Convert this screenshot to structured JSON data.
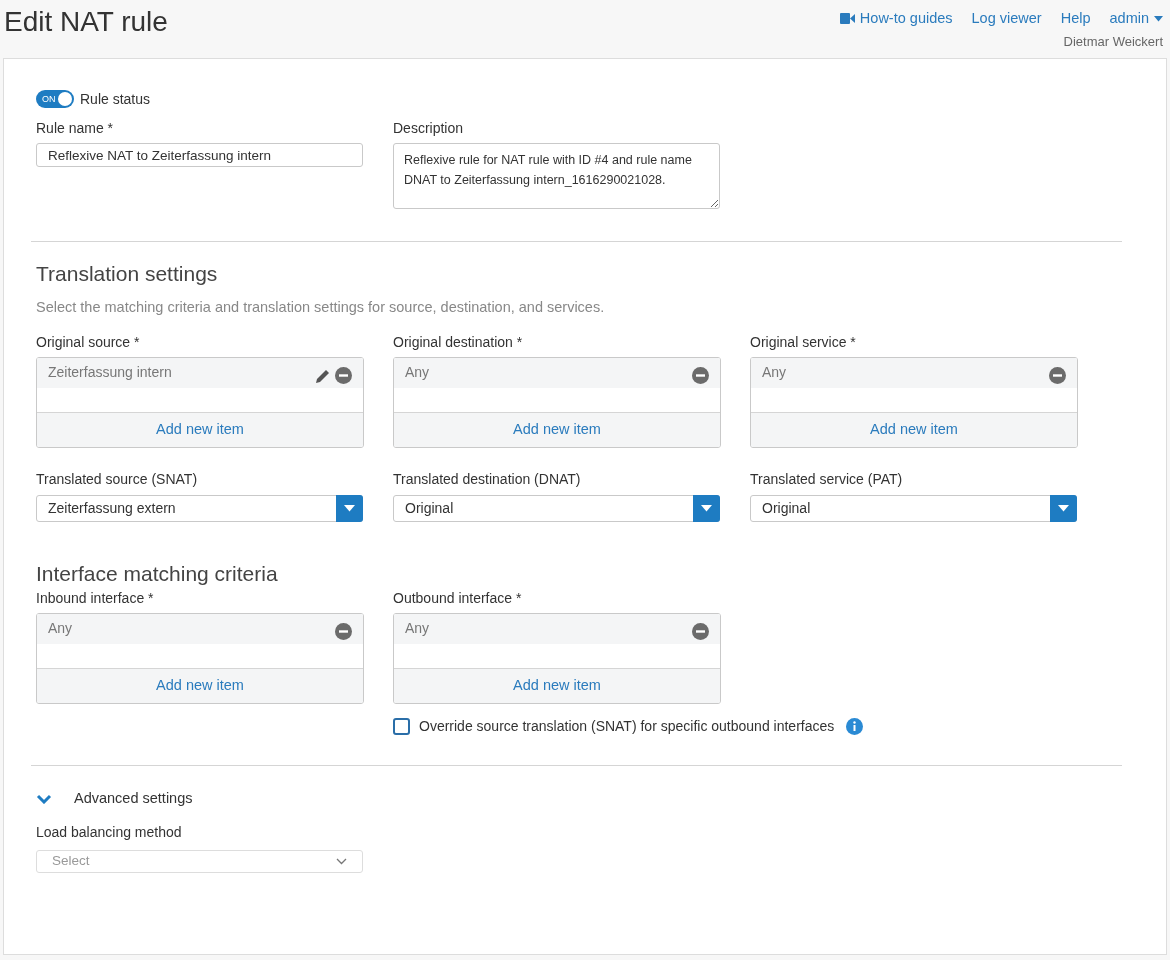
{
  "header": {
    "title": "Edit NAT rule",
    "links": [
      {
        "label": "How-to guides",
        "kind": "video"
      },
      {
        "label": "Log viewer",
        "kind": "plain"
      },
      {
        "label": "Help",
        "kind": "plain"
      },
      {
        "label": "admin",
        "kind": "menu"
      }
    ],
    "user": "Dietmar Weickert"
  },
  "rule_status": {
    "on": true,
    "toggle_text": "ON",
    "label": "Rule status"
  },
  "rule_name": {
    "label": "Rule name *",
    "value": "Reflexive NAT to Zeiterfassung intern"
  },
  "description": {
    "label": "Description",
    "value": "Reflexive rule for NAT rule with ID #4 and rule name DNAT to Zeiterfassung intern_1616290021028."
  },
  "translation": {
    "title": "Translation settings",
    "subtitle": "Select the matching criteria and translation settings for source, destination, and services.",
    "pickers": [
      {
        "label": "Original source *",
        "item": "Zeiterfassung intern",
        "editable": true,
        "add_label": "Add new item"
      },
      {
        "label": "Original destination *",
        "item": "Any",
        "editable": false,
        "add_label": "Add new item"
      },
      {
        "label": "Original service *",
        "item": "Any",
        "editable": false,
        "add_label": "Add new item"
      }
    ],
    "selects": [
      {
        "label": "Translated source (SNAT)",
        "value": "Zeiterfassung extern"
      },
      {
        "label": "Translated destination (DNAT)",
        "value": "Original"
      },
      {
        "label": "Translated service (PAT)",
        "value": "Original"
      }
    ]
  },
  "interface": {
    "title": "Interface matching criteria",
    "pickers": [
      {
        "label": "Inbound interface *",
        "item": "Any",
        "editable": false,
        "add_label": "Add new item"
      },
      {
        "label": "Outbound interface *",
        "item": "Any",
        "editable": false,
        "add_label": "Add new item"
      }
    ],
    "override": {
      "checked": false,
      "label": "Override source translation (SNAT) for specific outbound interfaces"
    }
  },
  "advanced": {
    "expanded": true,
    "label": "Advanced settings",
    "load_balancing": {
      "label": "Load balancing method",
      "placeholder": "Select"
    }
  }
}
